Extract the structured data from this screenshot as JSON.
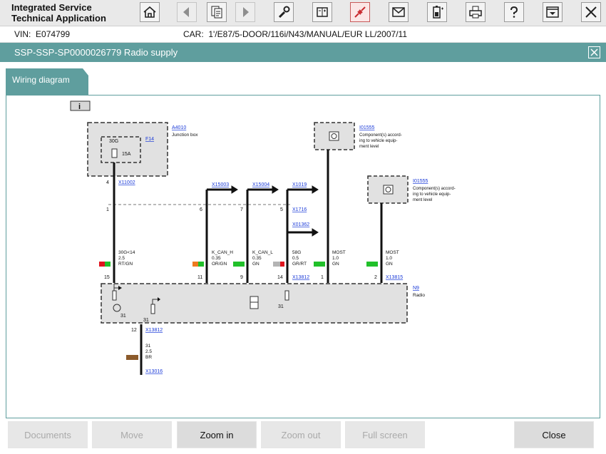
{
  "app": {
    "title_line1": "Integrated Service",
    "title_line2": "Technical Application"
  },
  "toolbar": {
    "buttons": [
      {
        "name": "home-button",
        "icon": "home-icon"
      },
      {
        "name": "back-button",
        "icon": "arrow-left-icon"
      },
      {
        "name": "documents-button",
        "icon": "documents-icon"
      },
      {
        "name": "forward-button",
        "icon": "arrow-right-icon"
      },
      {
        "name": "service-button",
        "icon": "wrench-icon"
      },
      {
        "name": "measuring-button",
        "icon": "measure-icon"
      },
      {
        "name": "connection-button",
        "icon": "plug-icon"
      },
      {
        "name": "message-button",
        "icon": "envelope-icon"
      },
      {
        "name": "battery-button",
        "icon": "battery-icon"
      },
      {
        "name": "print-button",
        "icon": "printer-icon"
      },
      {
        "name": "help-button",
        "icon": "question-icon"
      },
      {
        "name": "menu-button",
        "icon": "menu-down-icon"
      },
      {
        "name": "exit-button",
        "icon": "close-icon"
      }
    ]
  },
  "vehicle": {
    "vin_label": "VIN:",
    "vin": "E074799",
    "car_label": "CAR:",
    "car": "1'/E87/5-DOOR/116i/N43/MANUAL/EUR LL/2007/11"
  },
  "document": {
    "title": "SSP-SSP-SP0000026779 Radio supply"
  },
  "tabs": {
    "wiring": "Wiring diagram"
  },
  "diagram": {
    "info_label": "i",
    "junction_box": {
      "id": "A4010",
      "name": "Junction box"
    },
    "fuse": {
      "id": "F14",
      "terminal": "30G",
      "rating": "15A"
    },
    "comp1": {
      "id": "I01555",
      "line1": "Component(s) accord-",
      "line2": "ing to vehicle equip-",
      "line3": "ment level"
    },
    "comp2": {
      "id": "I01555",
      "line1": "Component(s) accord-",
      "line2": "ing to vehicle equip-",
      "line3": "ment level"
    },
    "connectors": {
      "x11002": "X11002",
      "x15003": "X15003",
      "x15004": "X15004",
      "x1019": "X1019",
      "x1716": "X1716",
      "x01362": "X01362",
      "x13812a": "X13812",
      "x13815": "X13815",
      "x13812b": "X13812",
      "x13016": "X13016"
    },
    "pins": {
      "p4": "4",
      "p1a": "1",
      "p6": "6",
      "p7": "7",
      "p5": "5",
      "p15": "15",
      "p11": "11",
      "p9": "9",
      "p14": "14",
      "p1b": "1",
      "p2": "2",
      "p12": "12"
    },
    "wires": {
      "w1": {
        "sig": "30G<14",
        "size": "2.5",
        "color": "RT/GN"
      },
      "w2": {
        "sig": "K_CAN_H",
        "size": "0.35",
        "color": "OR/GN"
      },
      "w3": {
        "sig": "K_CAN_L",
        "size": "0.35",
        "color": "GN"
      },
      "w4": {
        "sig": "58G",
        "size": "0.5",
        "color": "GR/RT"
      },
      "w5": {
        "sig": "MOST",
        "size": "1.0",
        "color": "GN"
      },
      "w6": {
        "sig": "MOST",
        "size": "1.0",
        "color": "GN"
      },
      "w7": {
        "sig": "31",
        "size": "2.5",
        "color": "BR"
      }
    },
    "radio": {
      "id": "N9",
      "name": "Radio",
      "g1": "31",
      "g2": "31",
      "g3": "31"
    }
  },
  "buttons": {
    "documents": "Documents",
    "move": "Move",
    "zoom_in": "Zoom in",
    "zoom_out": "Zoom out",
    "full_screen": "Full screen",
    "close": "Close"
  },
  "colors": {
    "accent": "#5f9e9e",
    "red": "#e0141e",
    "green": "#21c02a",
    "orange": "#ee7a20",
    "gray": "#b4b4b4",
    "brown": "#8b5a2b"
  }
}
